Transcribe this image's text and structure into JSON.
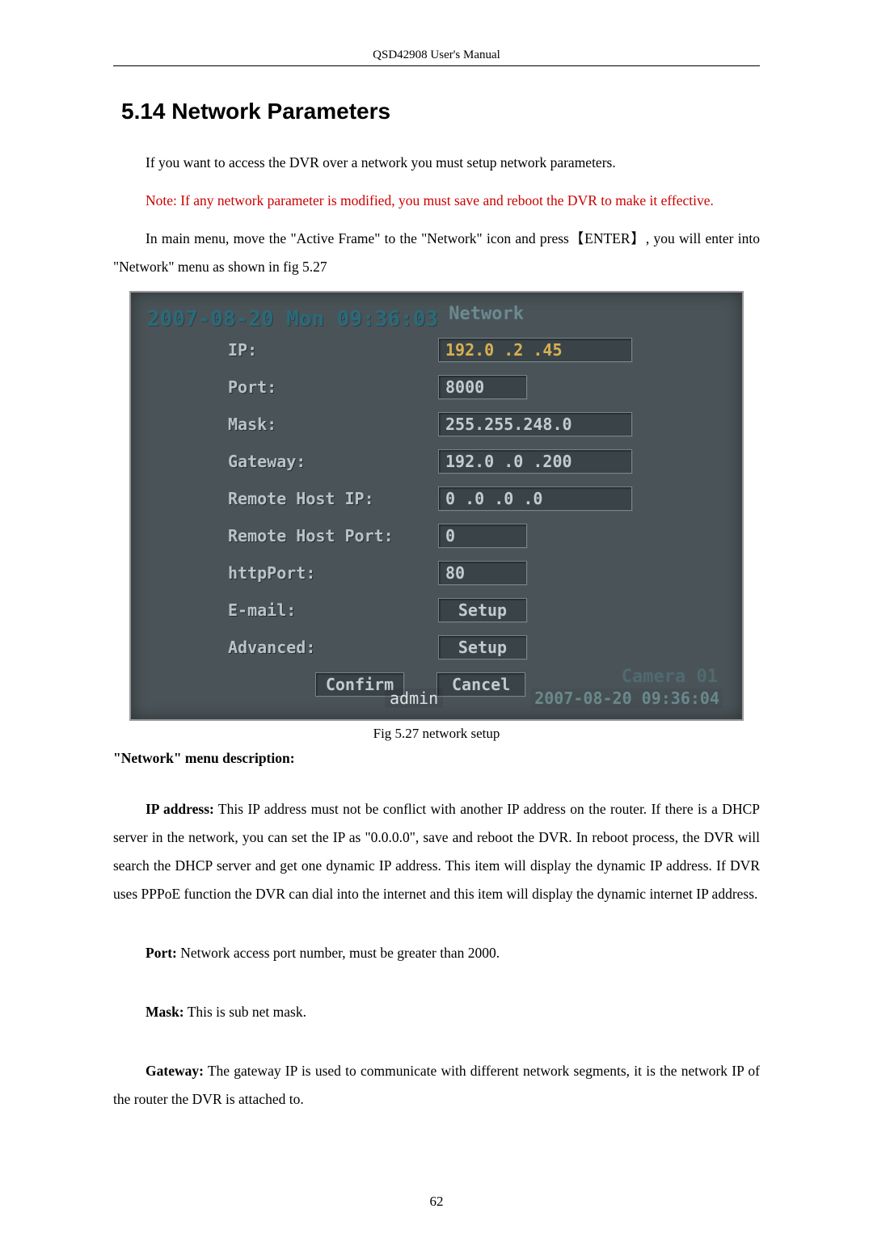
{
  "header": "QSD42908 User's Manual",
  "section_title": "5.14  Network Parameters",
  "intro_line": "If you want to access the DVR over a network you must setup network parameters.",
  "note_text": "Note: If any network parameter is modified, you must save and reboot the DVR to make it effective.",
  "main_menu_text_a": "In main menu, move the \"Active Frame\" to the \"Network\" icon and press",
  "enter_key": "【ENTER】",
  "main_menu_text_b": ", you will enter into \"Network\" menu as shown in fig 5.27",
  "screenshot": {
    "timestamp_top": "2007-08-20 Mon 09:36:03",
    "network_word": "Network",
    "rows": {
      "ip_label": "IP:",
      "ip_value": "192.0  .2  .45",
      "port_label": "Port:",
      "port_value": "8000",
      "mask_label": "Mask:",
      "mask_value": "255.255.248.0",
      "gateway_label": "Gateway:",
      "gateway_value": "192.0  .0  .200",
      "remotehostip_label": "Remote Host IP:",
      "remotehostip_value": "0   .0   .0   .0",
      "remotehostport_label": "Remote Host Port:",
      "remotehostport_value": "0",
      "httpport_label": "httpPort:",
      "httpport_value": "80",
      "email_label": "E-mail:",
      "email_value": "Setup",
      "advanced_label": "Advanced:",
      "advanced_value": "Setup"
    },
    "confirm": "Confirm",
    "cancel": "Cancel",
    "admin": "admin",
    "camera": "Camera 01",
    "timestamp_bottom": "2007-08-20 09:36:04"
  },
  "figure_caption": "Fig 5.27 network setup",
  "desc_heading": "\"Network\" menu description:",
  "ip_bold": "IP address:",
  "ip_desc": " This IP address must not be conflict with another IP address on the router. If there is a DHCP server in the network, you can set the IP as \"0.0.0.0\", save and reboot the DVR. In reboot process, the DVR will search the DHCP server and get one dynamic IP address. This item will display the dynamic IP address. If DVR uses PPPoE function the DVR can dial into the internet and this item will display the dynamic internet IP address.",
  "port_bold": "Port:",
  "port_desc": " Network access port number, must be greater than 2000.",
  "mask_bold": "Mask:",
  "mask_desc": " This is sub net mask.",
  "gateway_bold": "Gateway:",
  "gateway_desc": " The gateway IP is used to communicate with different network segments, it is the network IP of the router the DVR is attached to.",
  "page_number": "62"
}
